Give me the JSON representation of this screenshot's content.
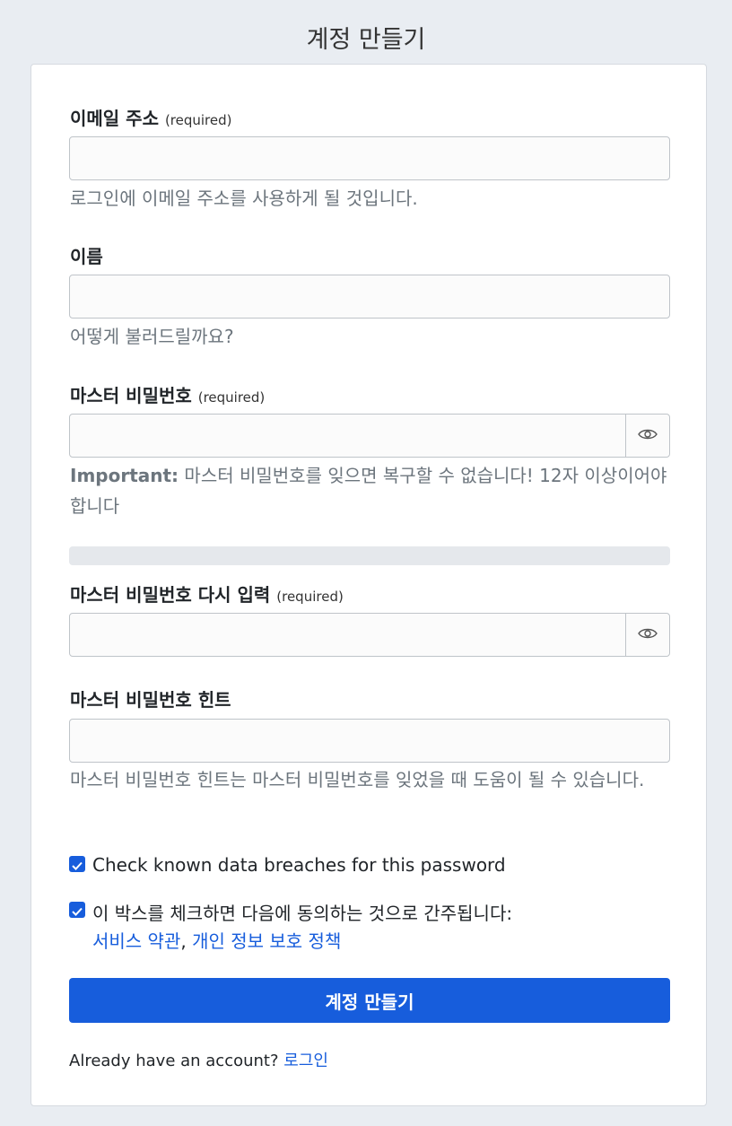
{
  "page": {
    "title": "계정 만들기"
  },
  "form": {
    "required_tag": "(required)",
    "email": {
      "label": "이메일 주소",
      "value": "",
      "help": "로그인에 이메일 주소를 사용하게 될 것입니다."
    },
    "name": {
      "label": "이름",
      "value": "",
      "help": "어떻게 불러드릴까요?"
    },
    "master_password": {
      "label": "마스터 비밀번호",
      "value": "",
      "help_strong": "Important:",
      "help": " 마스터 비밀번호를 잊으면 복구할 수 없습니다! 12자 이상이어야 합니다"
    },
    "retype_password": {
      "label": "마스터 비밀번호 다시 입력",
      "value": ""
    },
    "hint": {
      "label": "마스터 비밀번호 힌트",
      "value": "",
      "help": "마스터 비밀번호 힌트는 마스터 비밀번호를 잊었을 때 도움이 될 수 있습니다."
    },
    "check_breaches": {
      "label": "Check known data breaches for this password",
      "checked": true
    },
    "terms": {
      "label": "이 박스를 체크하면 다음에 동의하는 것으로 간주됩니다:",
      "checked": true,
      "terms_link": "서비스 약관",
      "separator": ",",
      "privacy_link": "개인 정보 보호 정책"
    },
    "submit_label": "계정 만들기",
    "already_text": "Already have an account?",
    "login_link": "로그인"
  },
  "icons": {
    "toggle_visibility": "eye-icon",
    "checkbox": "checkmark-icon"
  },
  "colors": {
    "accent": "#175ddc",
    "background": "#e9edf2",
    "card": "#ffffff",
    "muted": "#6c757d"
  }
}
